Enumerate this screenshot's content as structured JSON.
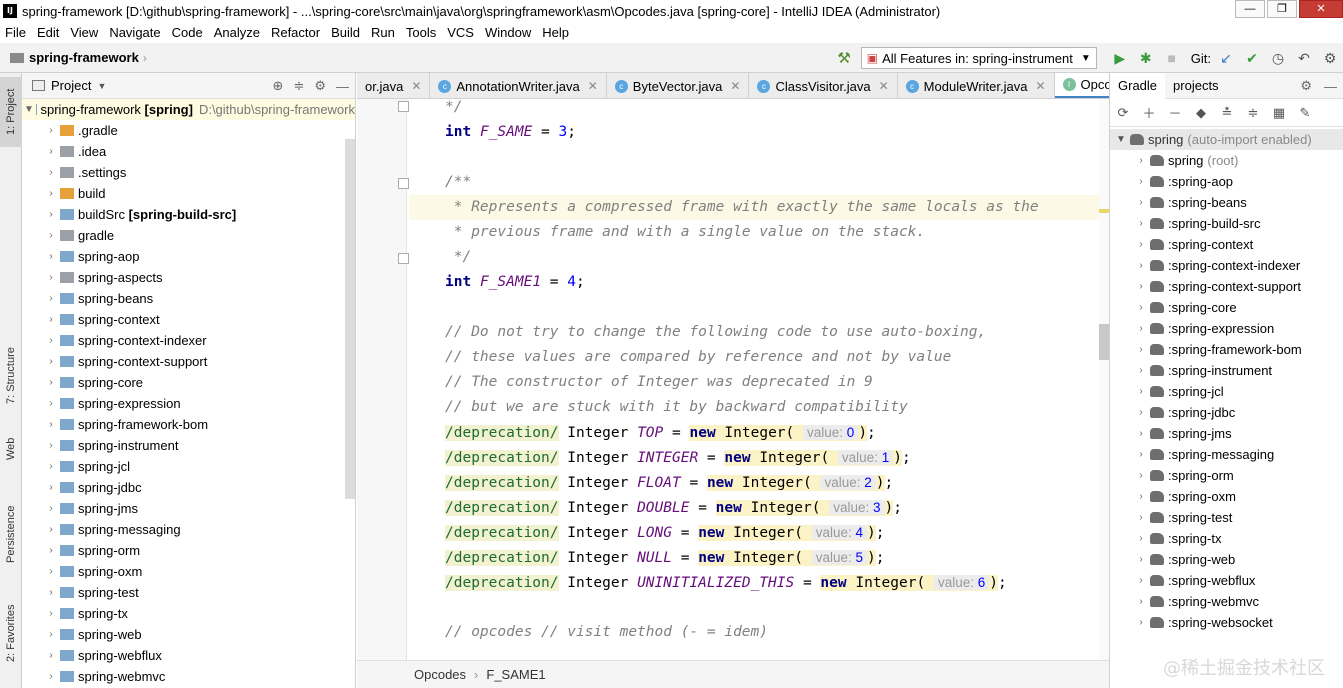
{
  "window": {
    "title": "spring-framework [D:\\github\\spring-framework] - ...\\spring-core\\src\\main\\java\\org\\springframework\\asm\\Opcodes.java [spring-core] - IntelliJ IDEA (Administrator)",
    "app_icon": "IJ"
  },
  "menu": [
    "File",
    "Edit",
    "View",
    "Navigate",
    "Code",
    "Analyze",
    "Refactor",
    "Build",
    "Run",
    "Tools",
    "VCS",
    "Window",
    "Help"
  ],
  "navbar": {
    "project": "spring-framework",
    "run_config": "All Features in: spring-instrument",
    "git_label": "Git:"
  },
  "left_strip": [
    "1: Project",
    "7: Structure",
    "Web",
    "Persistence",
    "2: Favorites"
  ],
  "project_panel": {
    "title": "Project",
    "root": {
      "name": "spring-framework",
      "module": "[spring]",
      "path": "D:\\github\\spring-framework"
    },
    "items": [
      {
        "name": ".gradle",
        "icon": "orange"
      },
      {
        "name": ".idea",
        "icon": "gray"
      },
      {
        "name": ".settings",
        "icon": "gray"
      },
      {
        "name": "build",
        "icon": "orange"
      },
      {
        "name": "buildSrc",
        "module": "[spring-build-src]",
        "icon": "module"
      },
      {
        "name": "gradle",
        "icon": "gray"
      },
      {
        "name": "spring-aop",
        "icon": "module"
      },
      {
        "name": "spring-aspects",
        "icon": "gray"
      },
      {
        "name": "spring-beans",
        "icon": "module"
      },
      {
        "name": "spring-context",
        "icon": "module"
      },
      {
        "name": "spring-context-indexer",
        "icon": "module"
      },
      {
        "name": "spring-context-support",
        "icon": "module"
      },
      {
        "name": "spring-core",
        "icon": "module"
      },
      {
        "name": "spring-expression",
        "icon": "module"
      },
      {
        "name": "spring-framework-bom",
        "icon": "module"
      },
      {
        "name": "spring-instrument",
        "icon": "module"
      },
      {
        "name": "spring-jcl",
        "icon": "module"
      },
      {
        "name": "spring-jdbc",
        "icon": "module"
      },
      {
        "name": "spring-jms",
        "icon": "module"
      },
      {
        "name": "spring-messaging",
        "icon": "module"
      },
      {
        "name": "spring-orm",
        "icon": "module"
      },
      {
        "name": "spring-oxm",
        "icon": "module"
      },
      {
        "name": "spring-test",
        "icon": "module"
      },
      {
        "name": "spring-tx",
        "icon": "module"
      },
      {
        "name": "spring-web",
        "icon": "module"
      },
      {
        "name": "spring-webflux",
        "icon": "module"
      },
      {
        "name": "spring-webmvc",
        "icon": "module"
      }
    ]
  },
  "editor": {
    "tabs": [
      {
        "label": "or.java"
      },
      {
        "label": "AnnotationWriter.java"
      },
      {
        "label": "ByteVector.java"
      },
      {
        "label": "ClassVisitor.java"
      },
      {
        "label": "ModuleWriter.java"
      },
      {
        "label": "Opcodes.j"
      }
    ],
    "code": {
      "l1": "*/",
      "l2_kw": "int",
      "l2_field": "F_SAME",
      "l2_num": "3",
      "l4": "/**",
      "l5": "* Represents a compressed frame with exactly the same locals as the",
      "l6": "* previous frame and with a single value on the stack.",
      "l7": "*/",
      "l8_kw": "int",
      "l8_field": "F_SAME1",
      "l8_num": "4",
      "c1": "// Do not try to change the following code to use auto-boxing,",
      "c2": "// these values are compared by reference and not by value",
      "c3": "// The constructor of Integer was deprecated in 9",
      "c4": "// but we are stuck with it by backward compatibility",
      "ints": [
        {
          "name": "TOP",
          "value": "0"
        },
        {
          "name": "INTEGER",
          "value": "1"
        },
        {
          "name": "FLOAT",
          "value": "2"
        },
        {
          "name": "DOUBLE",
          "value": "3"
        },
        {
          "name": "LONG",
          "value": "4"
        },
        {
          "name": "NULL",
          "value": "5"
        },
        {
          "name": "UNINITIALIZED_THIS",
          "value": "6"
        }
      ],
      "anno": "/deprecation/",
      "type": "Integer",
      "new_kw": "new",
      "hint_label": "value:",
      "c5": "// opcodes // visit method (- = idem)"
    },
    "breadcrumbs": [
      "Opcodes",
      "F_SAME1"
    ]
  },
  "gradle_panel": {
    "tabs": [
      "Gradle",
      "projects"
    ],
    "root": {
      "name": "spring",
      "note": "(auto-import enabled)"
    },
    "items": [
      {
        "name": "spring",
        "note": "(root)"
      },
      {
        "name": ":spring-aop"
      },
      {
        "name": ":spring-beans"
      },
      {
        "name": ":spring-build-src"
      },
      {
        "name": ":spring-context"
      },
      {
        "name": ":spring-context-indexer"
      },
      {
        "name": ":spring-context-support"
      },
      {
        "name": ":spring-core"
      },
      {
        "name": ":spring-expression"
      },
      {
        "name": ":spring-framework-bom"
      },
      {
        "name": ":spring-instrument"
      },
      {
        "name": ":spring-jcl"
      },
      {
        "name": ":spring-jdbc"
      },
      {
        "name": ":spring-jms"
      },
      {
        "name": ":spring-messaging"
      },
      {
        "name": ":spring-orm"
      },
      {
        "name": ":spring-oxm"
      },
      {
        "name": ":spring-test"
      },
      {
        "name": ":spring-tx"
      },
      {
        "name": ":spring-web"
      },
      {
        "name": ":spring-webflux"
      },
      {
        "name": ":spring-webmvc"
      },
      {
        "name": ":spring-websocket"
      }
    ]
  },
  "watermark": "@稀土掘金技术社区"
}
